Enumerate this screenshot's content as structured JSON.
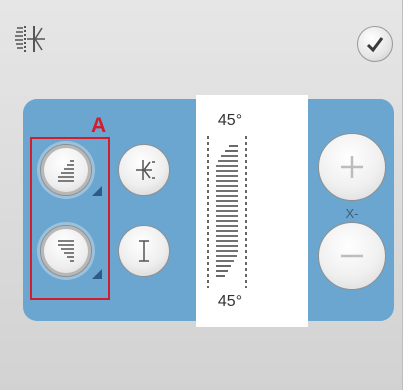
{
  "header": {
    "mirror_icon": "mirror-tapering-icon",
    "confirm_icon": "checkmark-icon"
  },
  "panel": {
    "callout_letter": "A",
    "angle_top": "45°",
    "angle_bottom": "45°",
    "step_label": "X-",
    "buttons": [
      {
        "name": "taper-start-button",
        "icon": "taper-start-icon"
      },
      {
        "name": "taper-end-button",
        "icon": "taper-end-icon"
      },
      {
        "name": "mirror-side-button",
        "icon": "mirror-side-icon"
      },
      {
        "name": "mirror-length-button",
        "icon": "mirror-length-icon"
      }
    ],
    "stepper": {
      "increase_icon": "plus-icon",
      "decrease_icon": "minus-icon"
    }
  },
  "colors": {
    "panel_blue": "#6aa6cf",
    "highlight_red": "#d41d2b",
    "screen_gray": "#d7d7d7"
  }
}
